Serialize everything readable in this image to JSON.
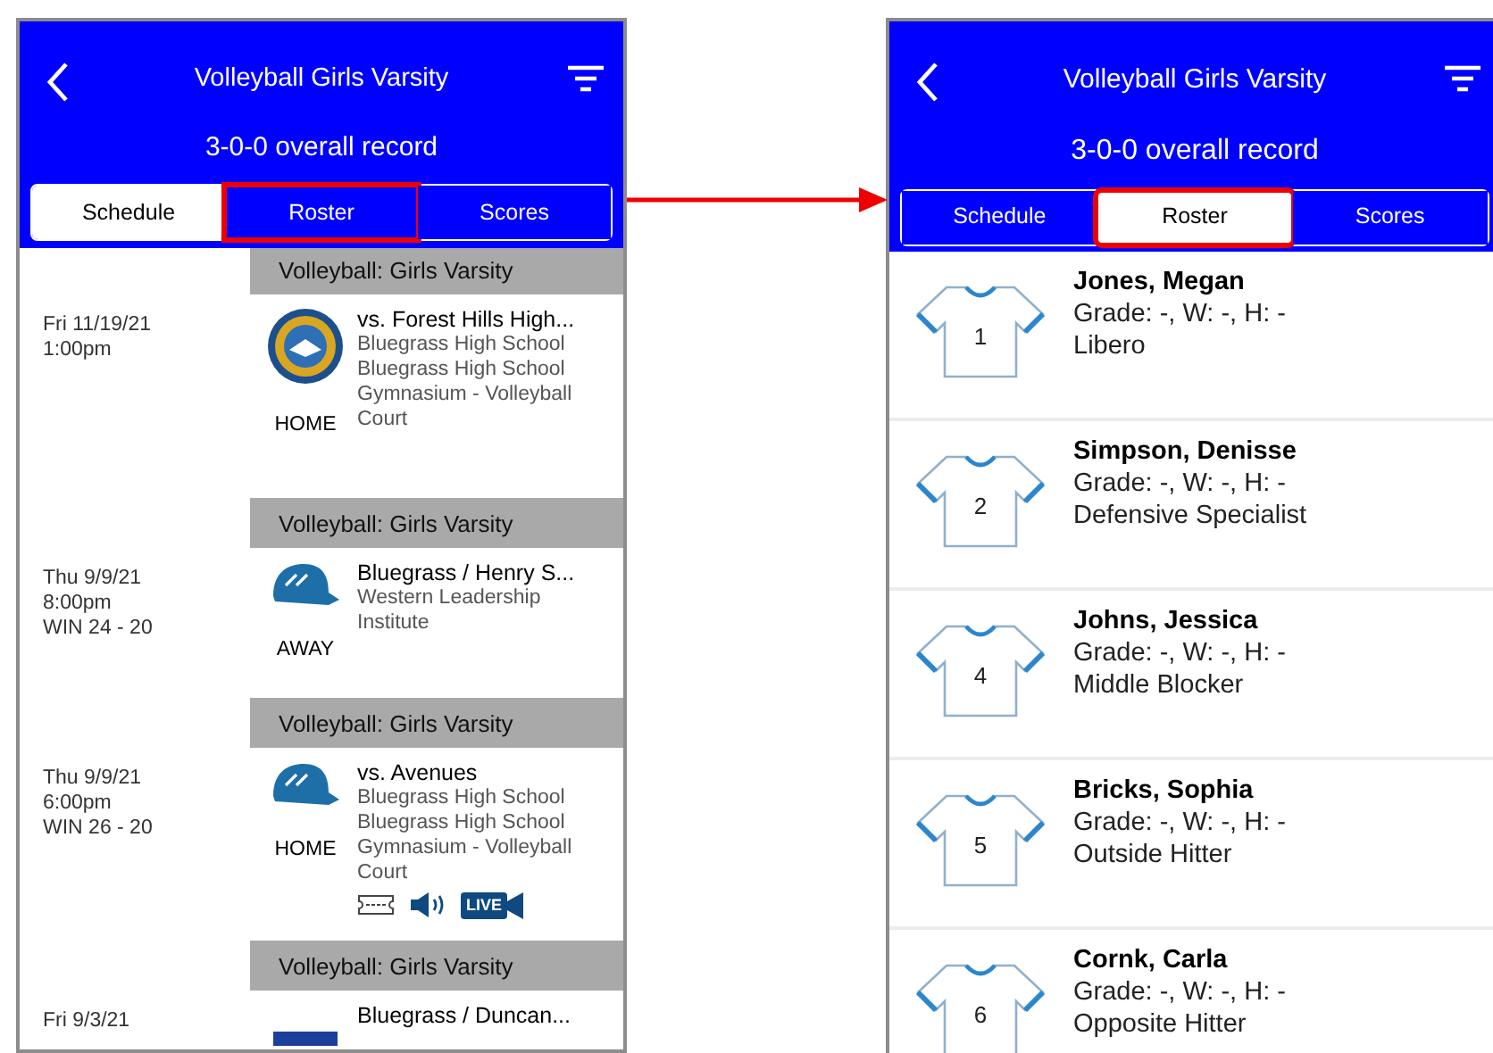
{
  "screens": [
    {
      "kind": "schedule",
      "header": {
        "title": "Volleyball Girls Varsity",
        "record": "3-0-0 overall record",
        "tabs": [
          {
            "label": "Schedule",
            "selected": true,
            "highlighted": false
          },
          {
            "label": "Roster",
            "selected": false,
            "highlighted": true
          },
          {
            "label": "Scores",
            "selected": false,
            "highlighted": false
          }
        ]
      },
      "events": [
        {
          "section": "Volleyball: Girls Varsity",
          "date_lines": [
            "Fri 11/19/21",
            "1:00pm"
          ],
          "logo": {
            "kind": "seal"
          },
          "venue_label": "HOME",
          "title": "vs. Forest Hills High...",
          "details": [
            "Bluegrass High School",
            "Bluegrass High School Gymnasium - Volleyball Court"
          ]
        },
        {
          "section": "Volleyball: Girls Varsity",
          "date_lines": [
            "Thu 9/9/21",
            "8:00pm",
            "WIN 24 - 20"
          ],
          "logo": {
            "kind": "cap"
          },
          "venue_label": "AWAY",
          "title": "Bluegrass / Henry S...",
          "details": [
            "Western Leadership Institute"
          ]
        },
        {
          "section": "Volleyball: Girls Varsity",
          "date_lines": [
            "Thu 9/9/21",
            "6:00pm",
            "WIN 26 - 20"
          ],
          "logo": {
            "kind": "cap"
          },
          "venue_label": "HOME",
          "title": "vs. Avenues",
          "details": [
            "Bluegrass High School",
            "Bluegrass High School Gymnasium - Volleyball Court"
          ],
          "media": [
            {
              "kind": "ticket"
            },
            {
              "kind": "audio"
            },
            {
              "kind": "live",
              "label": "LIVE"
            }
          ]
        },
        {
          "section": "Volleyball: Girls Varsity",
          "date_lines": [
            "Fri 9/3/21"
          ],
          "logo": {
            "kind": "banner"
          },
          "title": "Bluegrass / Duncan..."
        }
      ]
    },
    {
      "kind": "roster",
      "header": {
        "title": "Volleyball Girls Varsity",
        "record": "3-0-0 overall record",
        "tabs": [
          {
            "label": "Schedule",
            "selected": false,
            "highlighted": false
          },
          {
            "label": "Roster",
            "selected": true,
            "highlighted": true
          },
          {
            "label": "Scores",
            "selected": false,
            "highlighted": false
          }
        ]
      },
      "players": [
        {
          "number": "1",
          "name": "Jones, Megan",
          "stats": "Grade: -, W: -, H: -",
          "position": "Libero"
        },
        {
          "number": "2",
          "name": "Simpson, Denisse",
          "stats": "Grade: -, W: -, H: -",
          "position": "Defensive Specialist"
        },
        {
          "number": "4",
          "name": "Johns, Jessica",
          "stats": "Grade: -, W: -, H: -",
          "position": "Middle Blocker"
        },
        {
          "number": "5",
          "name": "Bricks, Sophia",
          "stats": "Grade: -, W: -, H: -",
          "position": "Outside Hitter"
        },
        {
          "number": "6",
          "name": "Cornk, Carla",
          "stats": "Grade: -, W: -, H: -",
          "position": "Opposite Hitter"
        }
      ]
    }
  ]
}
